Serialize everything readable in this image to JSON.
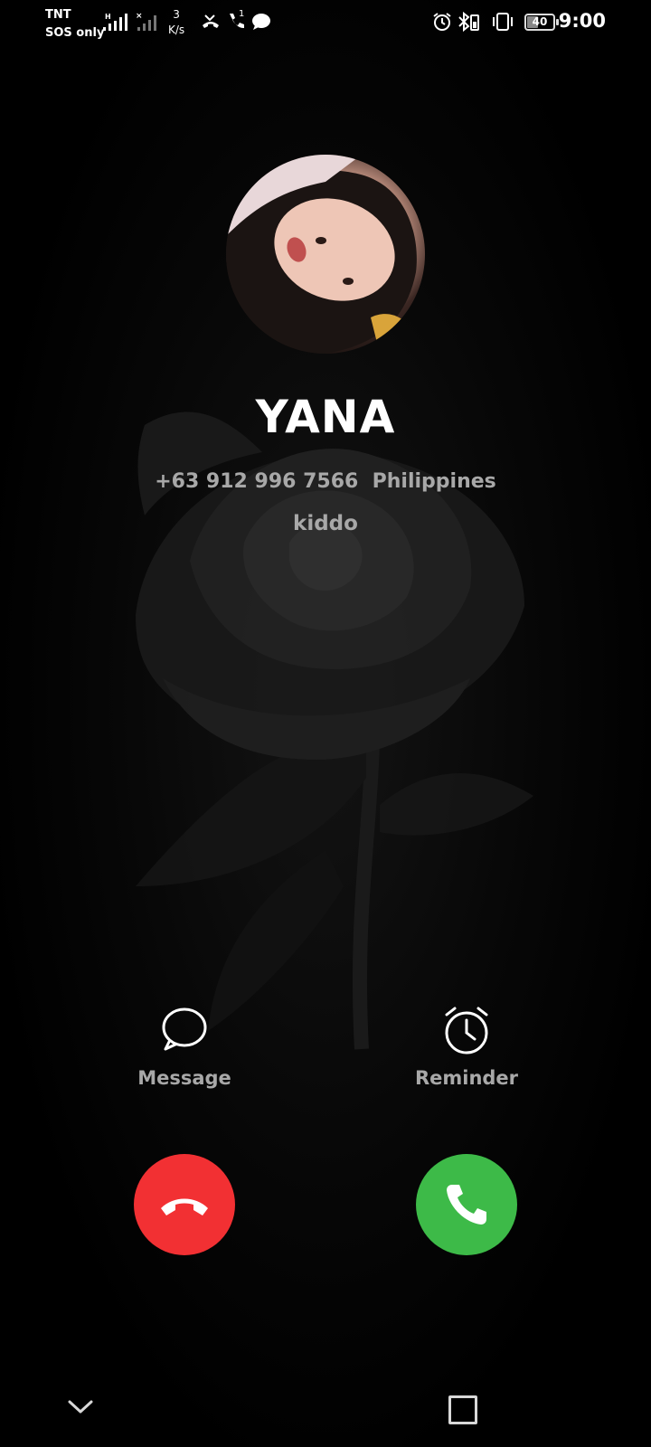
{
  "status_bar": {
    "carrier_line1": "TNT",
    "carrier_line2": "SOS only",
    "net_speed_value": "3",
    "net_speed_unit": "K/s",
    "missed_call_count": "1",
    "battery_level": "40",
    "time": "9:00",
    "icons": [
      "signal-icon",
      "signal-weak-icon",
      "missed-call-icon",
      "call-icon",
      "message-notification-icon",
      "alarm-icon",
      "bluetooth-battery-icon",
      "vibrate-icon",
      "battery-icon"
    ]
  },
  "caller": {
    "name": "YANA",
    "number": "+63 912 996 7566  Philippines",
    "label": "kiddo"
  },
  "actions": {
    "message_label": "Message",
    "reminder_label": "Reminder"
  },
  "call_buttons": {
    "decline_color": "#f23033",
    "accept_color": "#3dba48",
    "decline_icon": "phone-hangup-icon",
    "accept_icon": "phone-answer-icon"
  },
  "nav": {
    "icons": [
      "chevron-down-icon",
      "recents-square-icon"
    ]
  }
}
